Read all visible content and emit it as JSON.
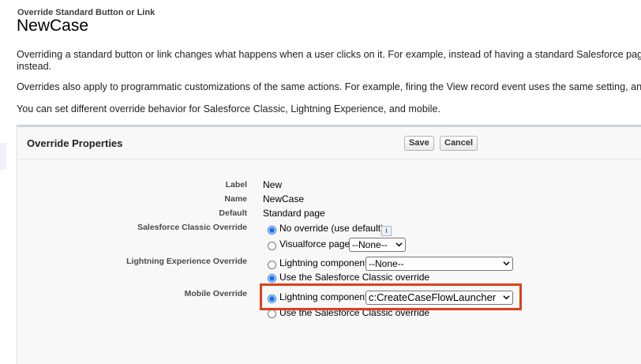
{
  "header": {
    "subtitle": "Override Standard Button or Link",
    "title": "NewCase"
  },
  "intro": {
    "p1_line1": "Overriding a standard button or link changes what happens when a user clicks on it. For example, instead of having a standard Salesforce page a",
    "p1_line2": "instead.",
    "p2": "Overrides also apply to programmatic customizations of the same actions. For example, firing the View record event uses the same setting, and p",
    "p3": "You can set different override behavior for Salesforce Classic, Lightning Experience, and mobile."
  },
  "panel": {
    "title": "Override Properties",
    "save_label": "Save",
    "cancel_label": "Cancel"
  },
  "fields": {
    "label_label": "Label",
    "label_value": "New",
    "name_label": "Name",
    "name_value": "NewCase",
    "default_label": "Default",
    "default_value": "Standard page",
    "classic_label": "Salesforce Classic Override",
    "classic_opt1": "No override (use default)",
    "classic_opt2": "Visualforce page",
    "classic_select": "--None--",
    "lex_label": "Lightning Experience Override",
    "lex_opt1": "Lightning component",
    "lex_select": "--None--",
    "lex_opt2": "Use the Salesforce Classic override",
    "mobile_label": "Mobile Override",
    "mobile_opt1": "Lightning component",
    "mobile_select": "c:CreateCaseFlowLauncher",
    "mobile_opt2": "Use the Salesforce Classic override",
    "info_icon_glyph": "i"
  },
  "colors": {
    "radio_selected": "#1a73e8",
    "highlight_border": "#d9411e"
  }
}
